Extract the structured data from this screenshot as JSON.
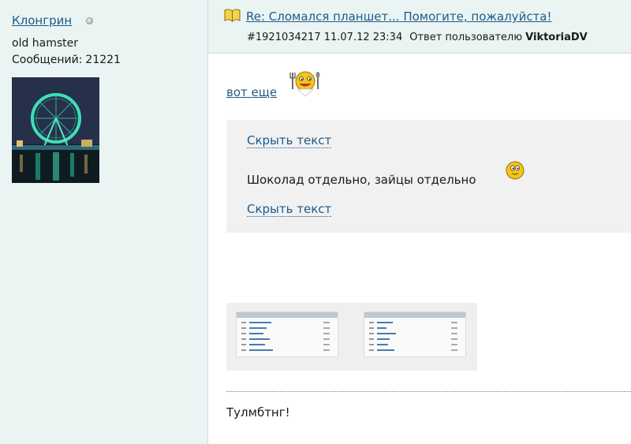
{
  "author": {
    "name": "Клонгрин",
    "title": "old hamster",
    "posts_label": "Сообщений:",
    "posts_count": "21221"
  },
  "post": {
    "title": "Re: Сломался планшет... Помогите, пожалуйста!",
    "id_date": "#1921034217 11.07.12 23:34",
    "reply_label": "Ответ пользователю",
    "reply_user": "ViktoriaDV"
  },
  "body": {
    "link_text": "вот еще",
    "spoiler": {
      "toggle_label": "Скрыть текст",
      "text": "Шоколад отдельно, зайцы отдельно"
    },
    "footer_text": "Тулмбтнг!"
  },
  "icons": {
    "status": "status-dot-icon",
    "post": "book-icon",
    "smiley_eat": "smiley-eating-icon",
    "smiley": "smiley-icon"
  },
  "colors": {
    "link": "#1d5a8a",
    "sidebar_bg": "#eaf4f3",
    "spoiler_bg": "#f1f1f1"
  }
}
